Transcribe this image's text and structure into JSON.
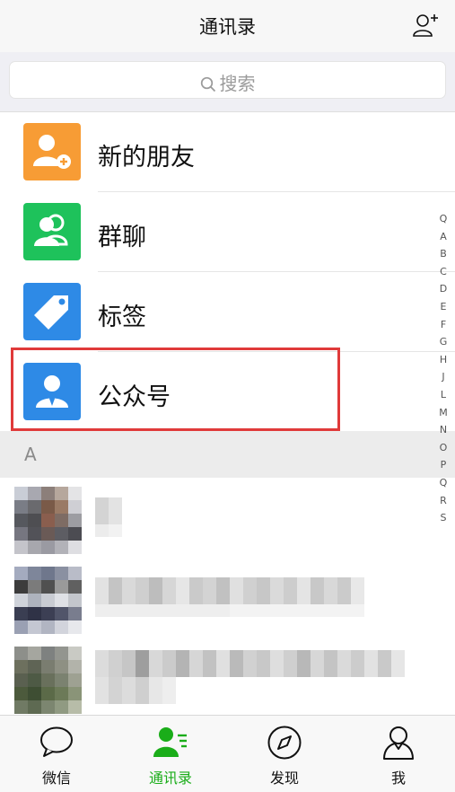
{
  "header": {
    "title": "通讯录",
    "add_icon": "add-friend-icon"
  },
  "search": {
    "placeholder": "搜索",
    "icon": "search-icon"
  },
  "features": [
    {
      "label": "新的朋友",
      "icon": "new-friend-icon",
      "color": "#f79c35"
    },
    {
      "label": "群聊",
      "icon": "group-chat-icon",
      "color": "#1ec25b"
    },
    {
      "label": "标签",
      "icon": "tag-icon",
      "color": "#2e8ae6"
    },
    {
      "label": "公众号",
      "icon": "official-account-icon",
      "color": "#2e8ae6"
    }
  ],
  "section": {
    "letter": "A"
  },
  "index_letters": [
    "Q",
    "A",
    "B",
    "C",
    "D",
    "E",
    "F",
    "G",
    "H",
    "J",
    "L",
    "M",
    "N",
    "O",
    "P",
    "Q",
    "R",
    "S"
  ],
  "tabs": [
    {
      "label": "微信",
      "icon": "chat-bubble-icon",
      "active": false
    },
    {
      "label": "通讯录",
      "icon": "contacts-icon",
      "active": true
    },
    {
      "label": "发现",
      "icon": "compass-icon",
      "active": false
    },
    {
      "label": "我",
      "icon": "person-icon",
      "active": false
    }
  ],
  "colors": {
    "accent": "#1aad19",
    "highlight": "#e03a3a"
  }
}
